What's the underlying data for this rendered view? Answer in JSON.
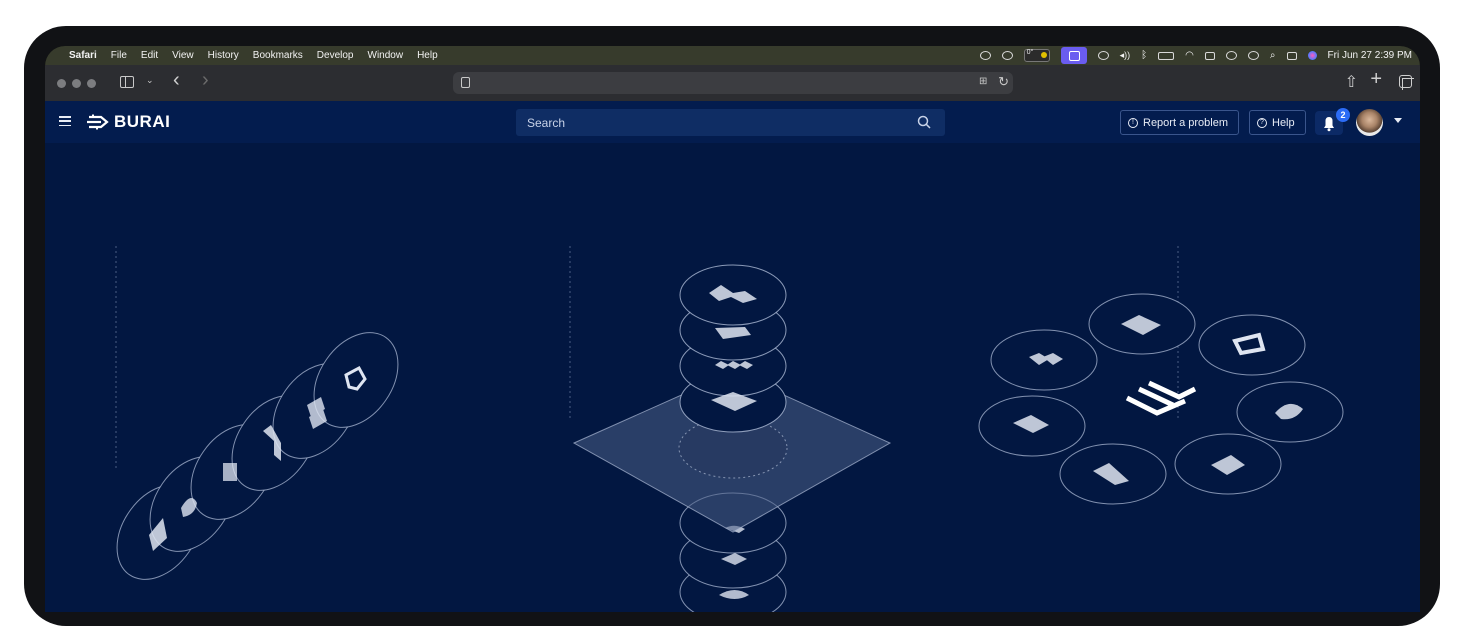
{
  "macos_menubar": {
    "apple_glyph": "",
    "app_name": "Safari",
    "menus": [
      "File",
      "Edit",
      "View",
      "History",
      "Bookmarks",
      "Develop",
      "Window",
      "Help"
    ],
    "focus_label": "0°",
    "datetime": "Fri Jun 27  2:39 PM"
  },
  "browser": {
    "address_text": ""
  },
  "app": {
    "logo_text": "BURAI",
    "search": {
      "placeholder": "Search"
    },
    "report_button": "Report a problem",
    "help_button": "Help",
    "notification_count": "2"
  },
  "colors": {
    "navbar_bg": "#031c4e",
    "content_bg": "#021741",
    "accent_blue": "#2c6cf6",
    "search_bg": "#0f2d64"
  },
  "icons": [
    "apple-icon",
    "hamburger-menu-icon",
    "burai-logo-icon",
    "search-icon",
    "info-circle-icon",
    "question-circle-icon",
    "bell-icon",
    "user-avatar",
    "chevron-down-icon",
    "sidebar-toggle-icon",
    "back-arrow-icon",
    "forward-arrow-icon",
    "share-icon",
    "new-tab-icon",
    "tab-overview-icon",
    "reload-icon",
    "translate-icon",
    "wifi-icon",
    "bluetooth-icon",
    "battery-icon",
    "volume-icon",
    "control-center-icon",
    "siri-icon"
  ]
}
